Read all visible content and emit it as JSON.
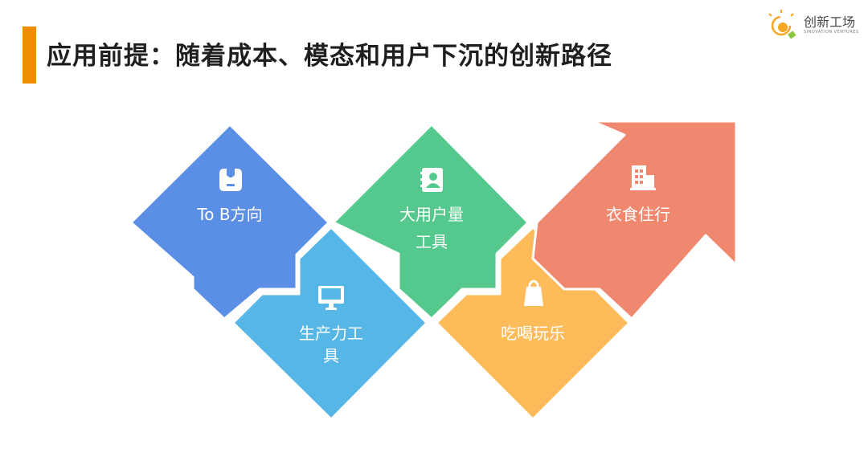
{
  "header": {
    "title": "应用前提：随着成本、模态和用户下沉的创新路径"
  },
  "logo": {
    "name": "创新工场",
    "subtitle": "SINOVATION VENTURES"
  },
  "diagram": {
    "nodes": [
      {
        "label_line1": "To B方向",
        "label_line2": "",
        "icon": "id-badge-icon",
        "color": "#5b8fe6"
      },
      {
        "label_line1": "生产力工",
        "label_line2": "具",
        "icon": "monitor-icon",
        "color": "#56b6e6"
      },
      {
        "label_line1": "大用户量",
        "label_line2": "工具",
        "icon": "contact-book-icon",
        "color": "#55c98d"
      },
      {
        "label_line1": "吃喝玩乐",
        "label_line2": "",
        "icon": "shopping-bag-icon",
        "color": "#fdbb59"
      },
      {
        "label_line1": "衣食住行",
        "label_line2": "",
        "icon": "building-icon",
        "color": "#f0876f"
      }
    ]
  }
}
